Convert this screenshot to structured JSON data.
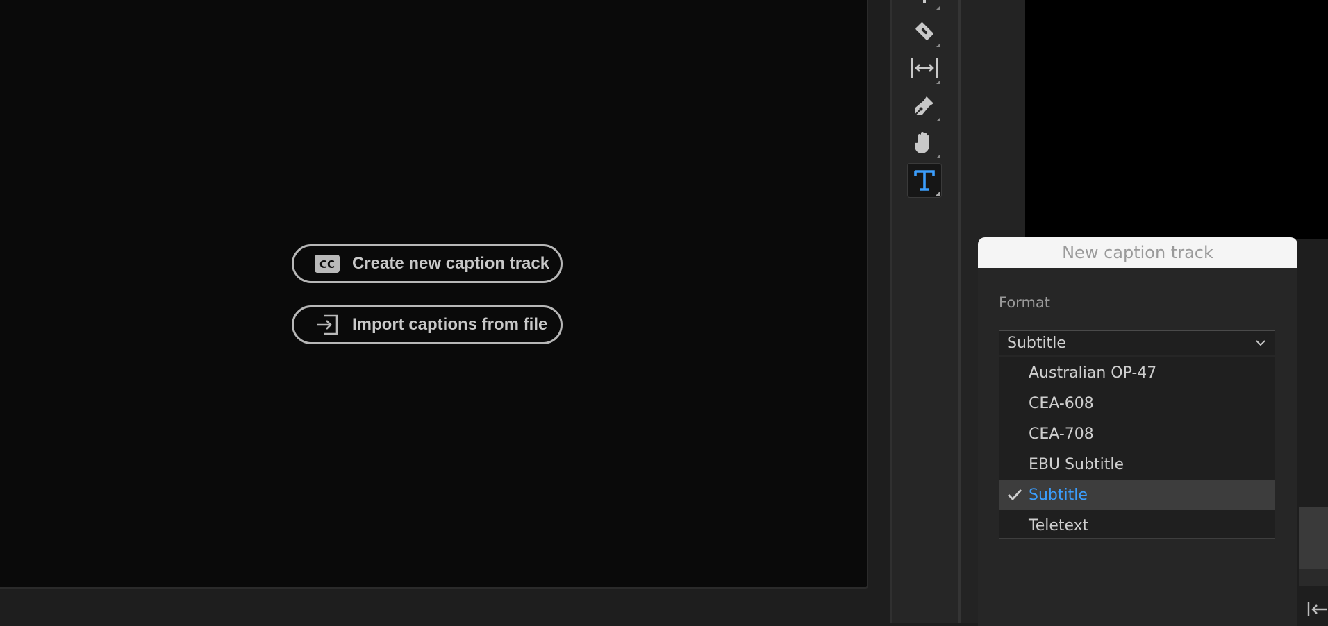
{
  "captions_panel": {
    "create_button": {
      "label": "Create new caption track",
      "icon": "cc-icon"
    },
    "import_button": {
      "label": "Import captions from file",
      "icon": "import-icon"
    }
  },
  "toolbar": {
    "tools": [
      {
        "name": "razor-tool",
        "icon": "razor-blade-icon"
      },
      {
        "name": "slip-tool",
        "icon": "slip-arrows-icon"
      },
      {
        "name": "pen-tool",
        "icon": "pen-icon"
      },
      {
        "name": "hand-tool",
        "icon": "hand-icon"
      },
      {
        "name": "type-tool",
        "icon": "type-t-icon",
        "active": true
      }
    ]
  },
  "dialog": {
    "title": "New caption track",
    "format_label": "Format",
    "selected_value": "Subtitle",
    "options": [
      "Australian OP-47",
      "CEA-608",
      "CEA-708",
      "EBU Subtitle",
      "Subtitle",
      "Teletext"
    ],
    "selected_index": 4
  },
  "colors": {
    "accent": "#3b9dfc",
    "panel_bg": "#0a0a0a",
    "app_bg": "#1e1e1e"
  }
}
